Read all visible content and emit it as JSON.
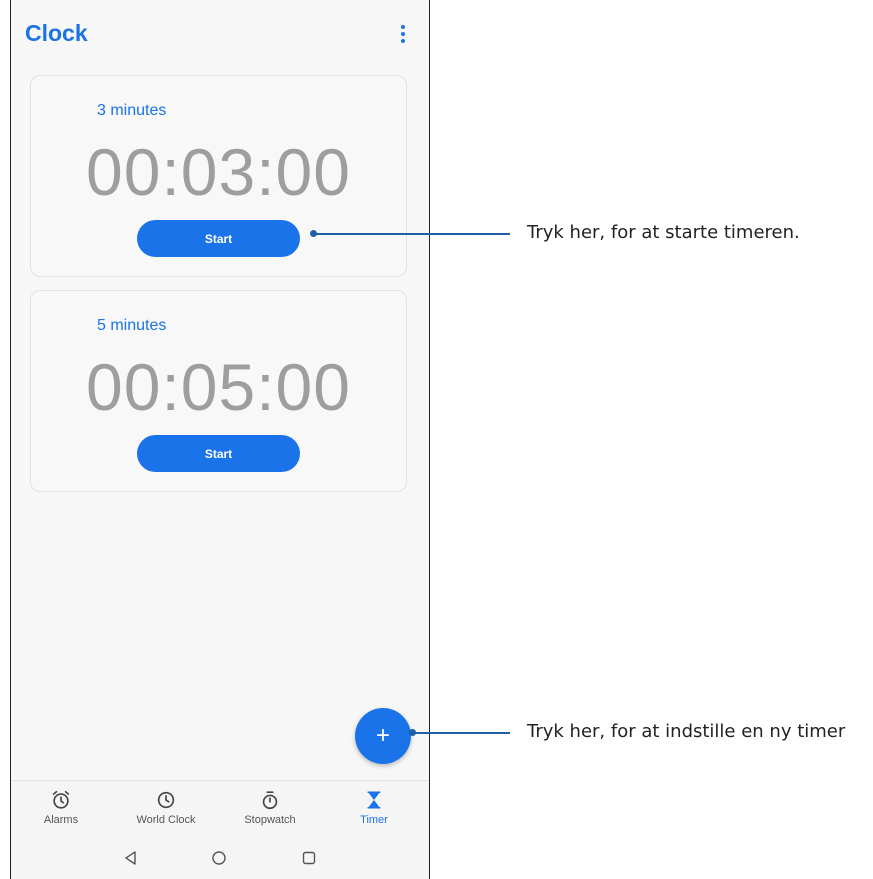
{
  "app": {
    "title": "Clock"
  },
  "timers": [
    {
      "label": "3 minutes",
      "value": "00:03:00",
      "button": "Start"
    },
    {
      "label": "5 minutes",
      "value": "00:05:00",
      "button": "Start"
    }
  ],
  "fab": {
    "icon": "plus-icon",
    "label": "+"
  },
  "nav": {
    "alarms": {
      "label": "Alarms",
      "icon": "alarm-clock-icon"
    },
    "world_clock": {
      "label": "World Clock",
      "icon": "clock-icon"
    },
    "stopwatch": {
      "label": "Stopwatch",
      "icon": "stopwatch-icon"
    },
    "timer": {
      "label": "Timer",
      "icon": "hourglass-icon"
    }
  },
  "system_nav": {
    "back": "back-icon",
    "home": "home-icon",
    "recents": "recents-icon"
  },
  "callouts": {
    "start": "Tryk her, for at starte timeren.",
    "add": "Tryk her, for at indstille en ny timer"
  },
  "colors": {
    "accent": "#1a73e8",
    "callout": "#1f5fa8"
  }
}
